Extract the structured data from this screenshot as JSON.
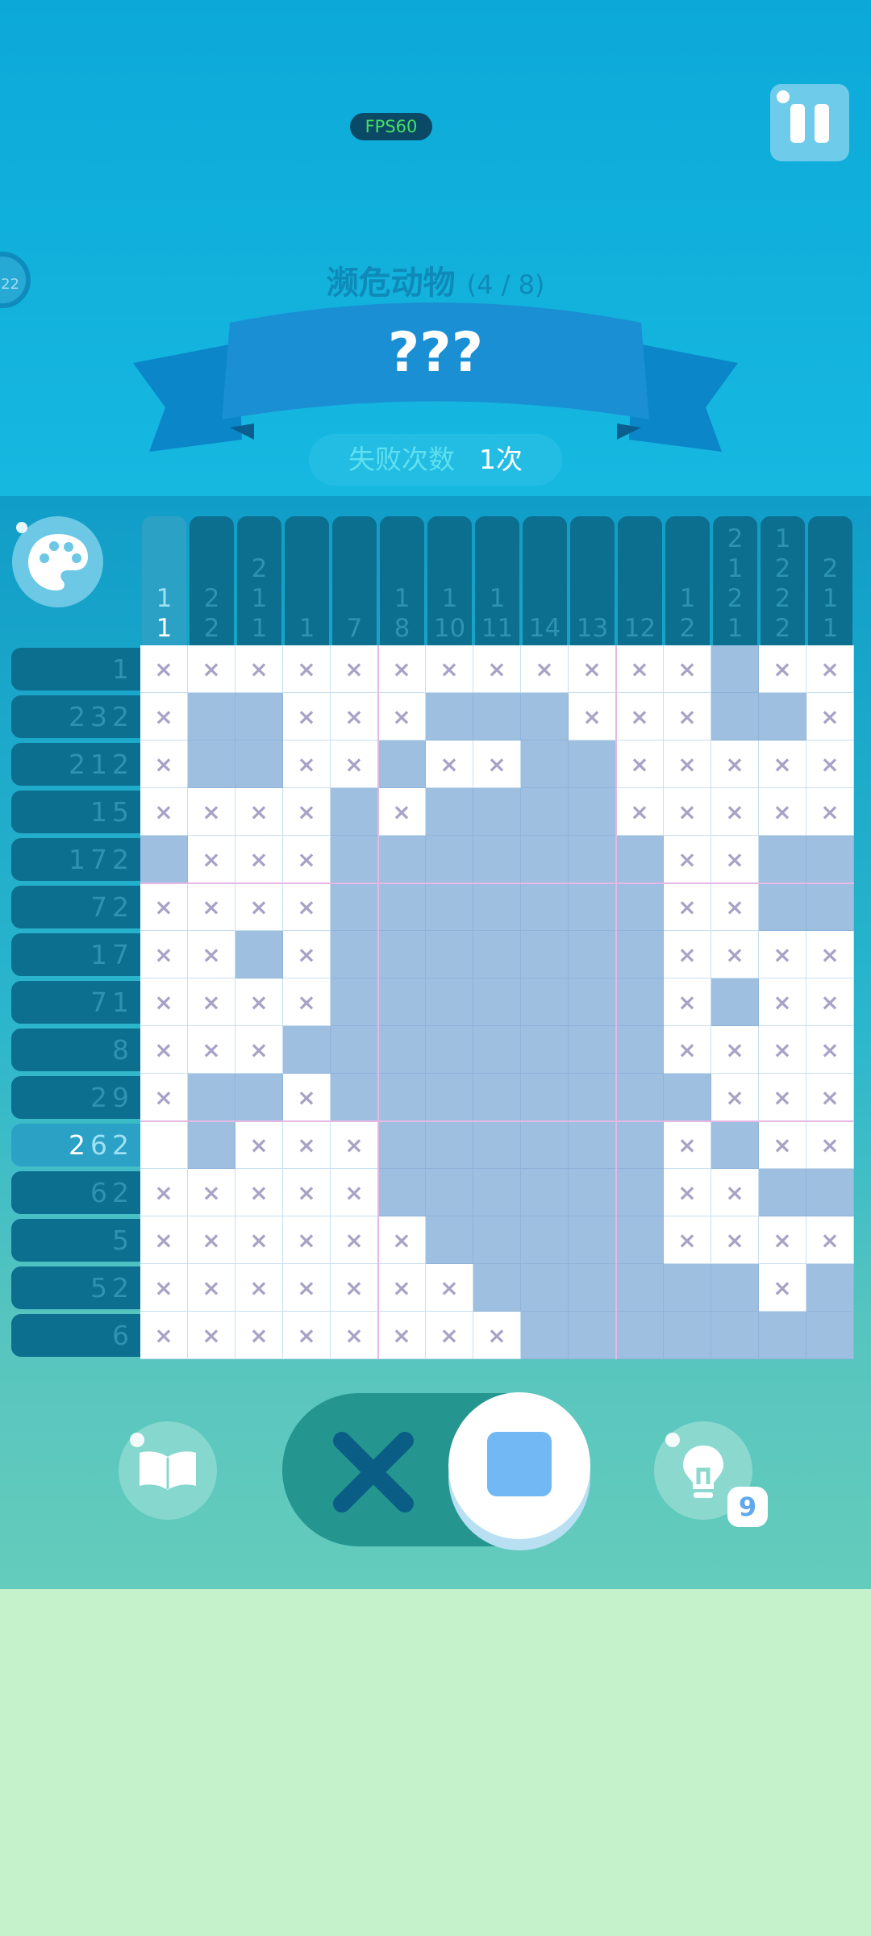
{
  "hud": {
    "fps": "FPS60",
    "side_timer": "22"
  },
  "level": {
    "category": "濒危动物",
    "progress": "(4 / 8)",
    "name": "???"
  },
  "fails": {
    "label": "失败次数",
    "value": "1次"
  },
  "col_clues": [
    [
      "1",
      "1"
    ],
    [
      "2",
      "2"
    ],
    [
      "2",
      "1",
      "1"
    ],
    [
      "1"
    ],
    [
      "7"
    ],
    [
      "1",
      "8"
    ],
    [
      "1",
      "10"
    ],
    [
      "1",
      "11"
    ],
    [
      "14"
    ],
    [
      "13"
    ],
    [
      "12"
    ],
    [
      "1",
      "2"
    ],
    [
      "2",
      "1",
      "2",
      "1"
    ],
    [
      "1",
      "2",
      "2",
      "2"
    ],
    [
      "2",
      "1",
      "1"
    ]
  ],
  "row_clues": [
    [
      "1"
    ],
    [
      "2",
      "3",
      "2"
    ],
    [
      "2",
      "1",
      "2"
    ],
    [
      "1",
      "5"
    ],
    [
      "1",
      "7",
      "2"
    ],
    [
      "7",
      "2"
    ],
    [
      "1",
      "7"
    ],
    [
      "7",
      "1"
    ],
    [
      "8"
    ],
    [
      "2",
      "9"
    ],
    [
      "2",
      "6",
      "2"
    ],
    [
      "6",
      "2"
    ],
    [
      "5"
    ],
    [
      "5",
      "2"
    ],
    [
      "6"
    ]
  ],
  "active_row": 10,
  "active_col": 0,
  "board": [
    "xxxxxxxxxxxxfxx",
    "xffxxxfffxxxffx",
    "xffxxfxxffxxxxx",
    "xxxxfxffffxxxxx",
    "fxxxfffffffxxff",
    "xxxxfffffffxxff",
    "xxfxfffffffxxxx",
    "xxxxfffffffxfxx",
    "xxxffffffffxxxx",
    "xffxffffffffxxx",
    ".fxxxffffffxfxx",
    "xxxxxffffffxxff",
    "xxxxxxfffffxxxx",
    "xxxxxxxffffffxf",
    "xxxxxxxxfffffffx"
  ],
  "controls": {
    "hint_count": "9",
    "mode": "fill"
  },
  "colors": {
    "filled": "#9ebfe0",
    "cross": "#a8a3c6",
    "accent": "#72b8f5"
  }
}
